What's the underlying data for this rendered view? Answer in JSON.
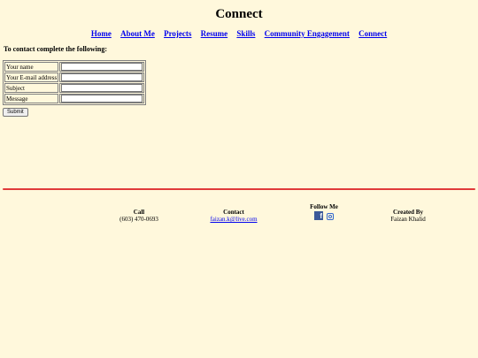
{
  "page": {
    "title": "Connect"
  },
  "nav": {
    "items": [
      "Home",
      "About Me",
      "Projects",
      "Resume",
      "Skills",
      "Community Engagement",
      "Connect"
    ]
  },
  "form": {
    "intro": "To contact complete the following:",
    "fields": [
      {
        "label": "Your name",
        "value": ""
      },
      {
        "label": "Your E-mail address",
        "value": ""
      },
      {
        "label": "Subject",
        "value": ""
      },
      {
        "label": "Message",
        "value": ""
      }
    ],
    "submit_label": "Submit"
  },
  "footer": {
    "call": {
      "heading": "Call",
      "value": "(603) 470-0693"
    },
    "contact": {
      "heading": "Contact",
      "email": "faizan.k@live.com"
    },
    "follow": {
      "heading": "Follow Me",
      "facebook_glyph": "f"
    },
    "created": {
      "heading": "Created By",
      "name": "Faizan Khalid"
    }
  },
  "colors": {
    "background": "#fff8dc",
    "link": "#0000ee",
    "rule": "#e03a3a",
    "facebook": "#3b5998"
  }
}
